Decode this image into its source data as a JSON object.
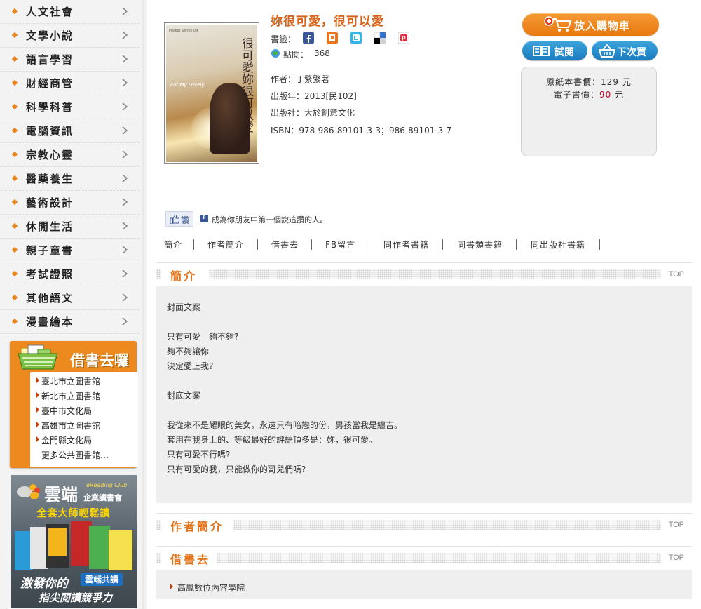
{
  "sidebar": {
    "categories": [
      {
        "label": "人文社會"
      },
      {
        "label": "文學小說"
      },
      {
        "label": "語言學習"
      },
      {
        "label": "財經商管"
      },
      {
        "label": "科學科普"
      },
      {
        "label": "電腦資訊"
      },
      {
        "label": "宗教心靈"
      },
      {
        "label": "醫藥養生"
      },
      {
        "label": "藝術設計"
      },
      {
        "label": "休閒生活"
      },
      {
        "label": "親子童書"
      },
      {
        "label": "考試證照"
      },
      {
        "label": "其他語文"
      },
      {
        "label": "漫畫繪本"
      }
    ],
    "library_box": {
      "title": "借書去囉",
      "links": [
        "臺北市立圖書館",
        "新北市立圖書館",
        "臺中市文化局",
        "高雄市立圖書館",
        "金門縣文化局"
      ],
      "more": "更多公共圖書館…"
    },
    "promo": {
      "brand": "雲端",
      "brand_en": "eReading Club",
      "brand_sub": "企業讀書會",
      "tagline": "全套大師輕鬆讀",
      "cta": "雲端共讀",
      "slogan1": "激發你的",
      "slogan2": "指尖閱讀競爭力"
    }
  },
  "book": {
    "title": "妳很可愛，很可以愛",
    "cover": {
      "vertical_title": "很可愛妳很可以愛",
      "en": "For My Lovely.",
      "small": "Pocket Series 04"
    },
    "bookmark_label": "書籤：",
    "clicks_label": "點閱：",
    "clicks": "368",
    "author_label": "作者：",
    "author": "丁繁繁著",
    "year_label": "出版年：",
    "year": "2013[民102]",
    "publisher_label": "出版社：",
    "publisher": "大於創意文化",
    "isbn_label": "ISBN：",
    "isbn": "978-986-89101-3-3；986-89101-3-7"
  },
  "actions": {
    "cart": "放入購物車",
    "preview": "試閱",
    "download": "下次買"
  },
  "price": {
    "paper_label": "原紙本書價：",
    "paper_value": "129",
    "ebook_label": "電子書價：",
    "ebook_value": "90",
    "unit": "元"
  },
  "social": {
    "like_label": "讚",
    "like_text": "成為你朋友中第一個說這讚的人。"
  },
  "tabs": [
    "簡介",
    "作者簡介",
    "借書去",
    "FB留言",
    "同作者書籍",
    "同書類書籍",
    "同出版社書籍"
  ],
  "sections": {
    "intro": {
      "title": "簡介",
      "top": "TOP",
      "lines": [
        "封面文案",
        "",
        "只有可愛　夠不夠?",
        "夠不夠讓你",
        "決定愛上我?",
        "",
        "封底文案",
        "",
        "我從來不是耀眼的美女，永遠只有暗戀的份，男孩當我是纏吉。",
        "套用在我身上的、等級最好的評語頂多是：妳，很可愛。",
        "只有可愛不行嗎?",
        "只有可愛的我，只能做你的哥兒們嗎?"
      ]
    },
    "author": {
      "title": "作者簡介",
      "top": "TOP"
    },
    "borrow": {
      "title": "借書去",
      "top": "TOP",
      "link": "高鳳數位內容學院"
    }
  },
  "colors": {
    "accent": "#e2741c",
    "title": "#d8641a",
    "button_orange": "#ef8a23",
    "button_blue": "#2590cf",
    "price_red": "#c6002b"
  }
}
